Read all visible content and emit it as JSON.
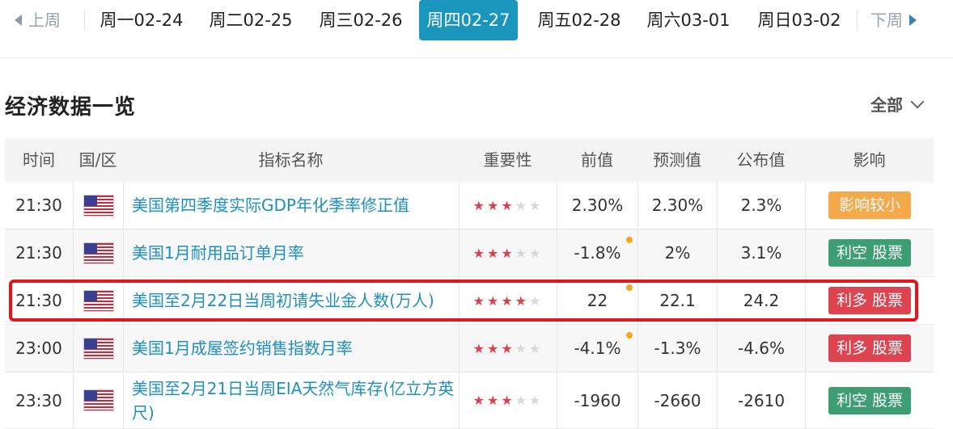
{
  "nav": {
    "prev_label": "上周",
    "next_label": "下周",
    "days": [
      {
        "label": "周一02-24",
        "active": false
      },
      {
        "label": "周二02-25",
        "active": false
      },
      {
        "label": "周三02-26",
        "active": false
      },
      {
        "label": "周四02-27",
        "active": true
      },
      {
        "label": "周五02-28",
        "active": false
      },
      {
        "label": "周六03-01",
        "active": false
      },
      {
        "label": "周日03-02",
        "active": false
      }
    ]
  },
  "section": {
    "title": "经济数据一览",
    "filter_label": "全部"
  },
  "table": {
    "headers": [
      "时间",
      "国/区",
      "指标名称",
      "重要性",
      "前值",
      "预测值",
      "公布值",
      "影响"
    ],
    "rows": [
      {
        "time": "21:30",
        "country_icon": "us-flag-icon",
        "name": "美国第四季度实际GDP年化季率修正值",
        "stars": 3,
        "prev": "2.30%",
        "prev_revised": false,
        "forecast": "2.30%",
        "actual": "2.3%",
        "impact": "影响较小",
        "impact_color": "#f5a94a"
      },
      {
        "time": "21:30",
        "country_icon": "us-flag-icon",
        "name": "美国1月耐用品订单月率",
        "stars": 3,
        "prev": "-1.8%",
        "prev_revised": true,
        "forecast": "2%",
        "actual": "3.1%",
        "impact": "利空 股票",
        "impact_color": "#3e9e73"
      },
      {
        "time": "21:30",
        "country_icon": "us-flag-icon",
        "name": "美国至2月22日当周初请失业金人数(万人)",
        "stars": 4,
        "prev": "22",
        "prev_revised": true,
        "forecast": "22.1",
        "actual": "24.2",
        "impact": "利多 股票",
        "impact_color": "#dd4450"
      },
      {
        "time": "23:00",
        "country_icon": "us-flag-icon",
        "name": "美国1月成屋签约销售指数月率",
        "stars": 3,
        "prev": "-4.1%",
        "prev_revised": true,
        "forecast": "-1.3%",
        "actual": "-4.6%",
        "impact": "利多 股票",
        "impact_color": "#dd4450"
      },
      {
        "time": "23:30",
        "country_icon": "us-flag-icon",
        "name": "美国至2月21日当周EIA天然气库存(亿立方英尺)",
        "stars": 3,
        "prev": "-1960",
        "prev_revised": false,
        "forecast": "-2660",
        "actual": "-2610",
        "impact": "利空 股票",
        "impact_color": "#3e9e73"
      }
    ]
  },
  "colors": {
    "accent": "#1a96bd",
    "link": "#1f8fc0",
    "highlight_border": "#e8141c",
    "revised_dot": "#f5a623",
    "star_on": "#d9434d",
    "star_off": "#d8d8d8"
  }
}
